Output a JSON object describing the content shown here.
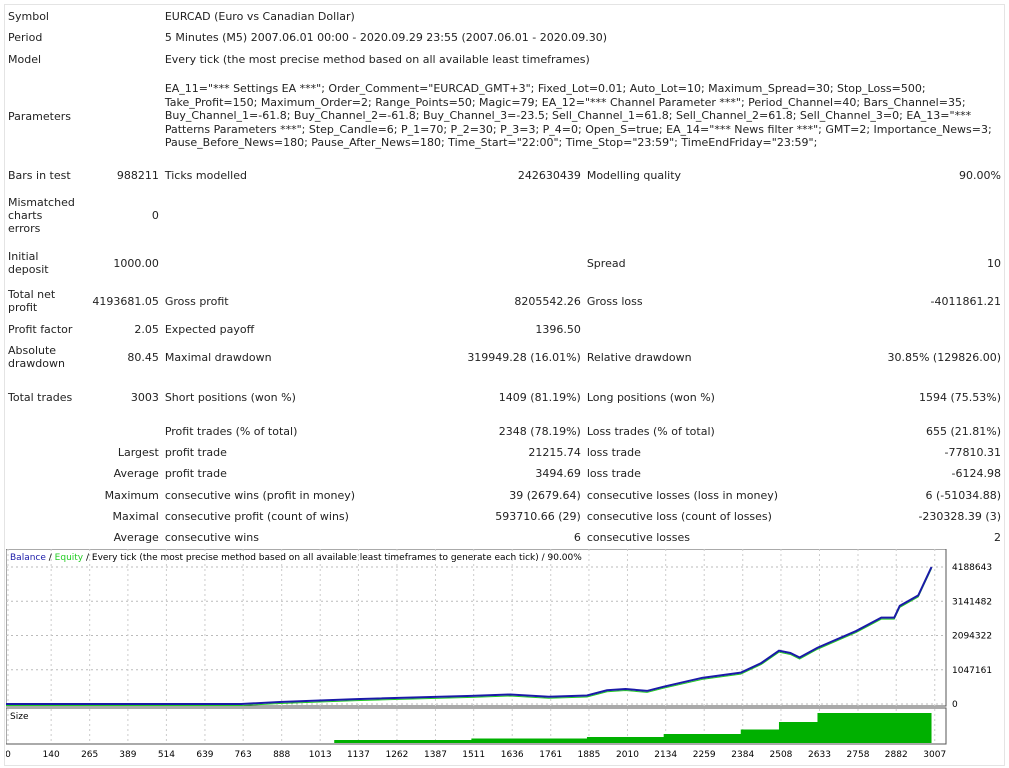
{
  "report": {
    "symbol_label": "Symbol",
    "symbol": "EURCAD (Euro vs Canadian Dollar)",
    "period_label": "Period",
    "period": "5 Minutes (M5) 2007.06.01 00:00 - 2020.09.29 23:55 (2007.06.01 - 2020.09.30)",
    "model_label": "Model",
    "model": "Every tick (the most precise method based on all available least timeframes)",
    "parameters_label": "Parameters",
    "parameters": "EA_11=\"*** Settings EA ***\"; Order_Comment=\"EURCAD_GMT+3\"; Fixed_Lot=0.01; Auto_Lot=10; Maximum_Spread=30; Stop_Loss=500; Take_Profit=150; Maximum_Order=2; Range_Points=50; Magic=79; EA_12=\"*** Channel Parameter ***\"; Period_Channel=40; Bars_Channel=35; Buy_Channel_1=-61.8; Buy_Channel_2=-61.8; Buy_Channel_3=-23.5; Sell_Channel_1=61.8; Sell_Channel_2=61.8; Sell_Channel_3=0; EA_13=\"*** Patterns Parameters ***\"; Step_Candle=6; P_1=70; P_2=30; P_3=3; P_4=0; Open_S=true; EA_14=\"*** News filter ***\"; GMT=2; Importance_News=3; Pause_Before_News=180; Pause_After_News=180; Time_Start=\"22:00\"; Time_Stop=\"23:59\"; TimeEndFriday=\"23:59\";",
    "bars_label": "Bars in test",
    "bars": "988211",
    "ticks_label": "Ticks modelled",
    "ticks": "242630439",
    "quality_label": "Modelling quality",
    "quality": "90.00%",
    "mismatch_label": "Mismatched charts errors",
    "mismatch": "0",
    "deposit_label": "Initial deposit",
    "deposit": "1000.00",
    "spread_label": "Spread",
    "spread": "10",
    "net_label": "Total net profit",
    "net": "4193681.05",
    "gp_label": "Gross profit",
    "gp": "8205542.26",
    "gl_label": "Gross loss",
    "gl": "-4011861.21",
    "pf_label": "Profit factor",
    "pf": "2.05",
    "ep_label": "Expected payoff",
    "ep": "1396.50",
    "ad_label": "Absolute drawdown",
    "ad": "80.45",
    "md_label": "Maximal drawdown",
    "md": "319949.28 (16.01%)",
    "rd_label": "Relative drawdown",
    "rd": "30.85% (129826.00)",
    "tt_label": "Total trades",
    "tt": "3003",
    "sp_label": "Short positions (won %)",
    "sp": "1409 (81.19%)",
    "lp_label": "Long positions (won %)",
    "lp": "1594 (75.53%)",
    "pt_label": "Profit trades (% of total)",
    "pt": "2348 (78.19%)",
    "lt_label": "Loss trades (% of total)",
    "lt": "655 (21.81%)",
    "largest_label": "Largest",
    "lpt_label": "profit trade",
    "lpt": "21215.74",
    "llt_label": "loss trade",
    "llt": "-77810.31",
    "average_label": "Average",
    "apt_label": "profit trade",
    "apt": "3494.69",
    "alt_label": "loss trade",
    "alt": "-6124.98",
    "maximum_label": "Maximum",
    "mcw_label": "consecutive wins (profit in money)",
    "mcw": "39 (2679.64)",
    "mcl_label": "consecutive losses (loss in money)",
    "mcl": "6 (-51034.88)",
    "maximal_label": "Maximal",
    "mcp_label": "consecutive profit (count of wins)",
    "mcp": "593710.66 (29)",
    "mclc_label": "consecutive loss (count of losses)",
    "mclc": "-230328.39 (3)",
    "average2_label": "Average",
    "acw_label": "consecutive wins",
    "acw": "6",
    "acl_label": "consecutive losses",
    "acl": "2"
  },
  "chart_data": {
    "type": "line",
    "legend": {
      "balance": "Balance",
      "equity": "Equity",
      "sep": " / ",
      "rest": " / Every tick (the most precise method based on all available least timeframes to generate each tick) / 90.00%"
    },
    "colors": {
      "balance": "#1a1aa8",
      "equity": "#22cc22",
      "size": "#00b000"
    },
    "yticks": [
      "4188643",
      "3141482",
      "2094322",
      "1047161",
      "0"
    ],
    "ylim": [
      0,
      4188643
    ],
    "xticks": [
      "0",
      "140",
      "265",
      "389",
      "514",
      "639",
      "763",
      "888",
      "1013",
      "1137",
      "1262",
      "1387",
      "1511",
      "1636",
      "1761",
      "1885",
      "2010",
      "2134",
      "2259",
      "2384",
      "2508",
      "2633",
      "2758",
      "2882",
      "3007"
    ],
    "xlim": [
      0,
      3050
    ],
    "size_label": "Size",
    "balance": [
      [
        0,
        1000
      ],
      [
        763,
        1000
      ],
      [
        888,
        60000
      ],
      [
        1137,
        150000
      ],
      [
        1511,
        250000
      ],
      [
        1636,
        290000
      ],
      [
        1761,
        220000
      ],
      [
        1885,
        260000
      ],
      [
        1950,
        420000
      ],
      [
        2010,
        460000
      ],
      [
        2080,
        400000
      ],
      [
        2134,
        530000
      ],
      [
        2259,
        800000
      ],
      [
        2384,
        960000
      ],
      [
        2450,
        1250000
      ],
      [
        2508,
        1630000
      ],
      [
        2545,
        1560000
      ],
      [
        2575,
        1420000
      ],
      [
        2633,
        1720000
      ],
      [
        2758,
        2230000
      ],
      [
        2840,
        2640000
      ],
      [
        2882,
        2640000
      ],
      [
        2900,
        3000000
      ],
      [
        2960,
        3320000
      ],
      [
        3003,
        4188643
      ]
    ],
    "size": [
      [
        0,
        0
      ],
      [
        1060,
        0
      ],
      [
        1065,
        0.1
      ],
      [
        1510,
        0.15
      ],
      [
        1885,
        0.2
      ],
      [
        2134,
        0.3
      ],
      [
        2384,
        0.45
      ],
      [
        2508,
        0.7
      ],
      [
        2633,
        1
      ],
      [
        3003,
        1
      ]
    ]
  }
}
